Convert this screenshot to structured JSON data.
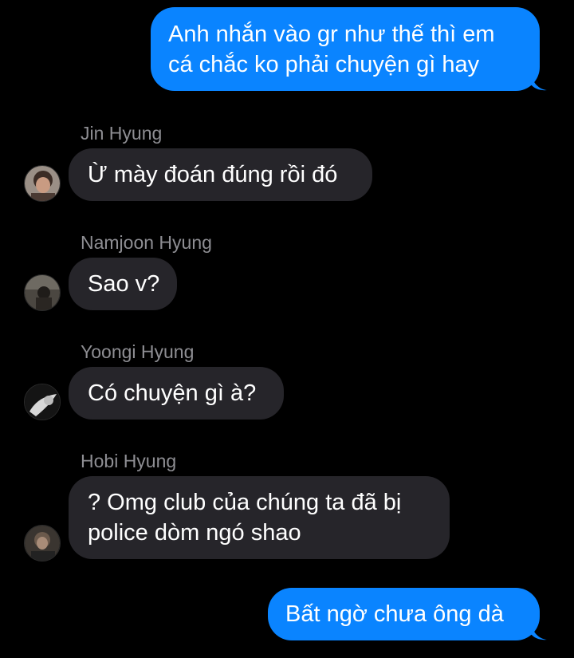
{
  "conversation": {
    "messages": [
      {
        "direction": "outgoing",
        "lines": [
          "Anh nhắn vào gr như thế thì em",
          "cá chắc ko phải chuyện gì hay"
        ]
      },
      {
        "direction": "incoming",
        "sender": "Jin Hyung",
        "avatar_icon": "jin-avatar",
        "lines": [
          "Ừ mày đoán đúng rồi đó"
        ]
      },
      {
        "direction": "incoming",
        "sender": "Namjoon Hyung",
        "avatar_icon": "namjoon-avatar",
        "lines": [
          "Sao v?"
        ]
      },
      {
        "direction": "incoming",
        "sender": "Yoongi Hyung",
        "avatar_icon": "yoongi-avatar",
        "lines": [
          "Có chuyện gì à?"
        ]
      },
      {
        "direction": "incoming",
        "sender": "Hobi Hyung",
        "avatar_icon": "hobi-avatar",
        "lines": [
          "? Omg club của chúng ta đã bị",
          "police dòm ngó shao"
        ]
      },
      {
        "direction": "outgoing",
        "lines": [
          "Bất ngờ chưa ông dà"
        ]
      }
    ]
  },
  "colors": {
    "background": "#000000",
    "outgoing_bubble": "#0a84ff",
    "incoming_bubble": "#26252a",
    "sender_name": "#8e8e93",
    "text": "#ffffff"
  }
}
